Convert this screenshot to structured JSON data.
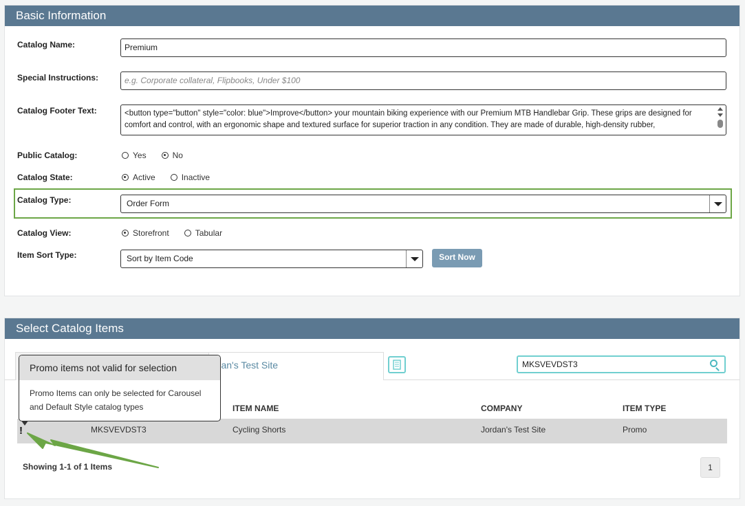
{
  "basic": {
    "header": "Basic Information",
    "catalog_name_label": "Catalog Name:",
    "catalog_name_value": "Premium",
    "special_label": "Special Instructions:",
    "special_placeholder": "e.g. Corporate collateral, Flipbooks, Under $100",
    "footer_label": "Catalog Footer Text:",
    "footer_value": "<button type=\"button\" style=\"color: blue\">Improve</button> your mountain biking experience with our Premium MTB Handlebar Grip. These grips are designed for comfort and control, with an ergonomic shape and textured surface for superior traction in any condition. They are made of durable, high-density rubber,",
    "public_label": "Public Catalog:",
    "public_yes": "Yes",
    "public_no": "No",
    "state_label": "Catalog State:",
    "state_active": "Active",
    "state_inactive": "Inactive",
    "type_label": "Catalog Type:",
    "type_value": "Order Form",
    "view_label": "Catalog View:",
    "view_storefront": "Storefront",
    "view_tabular": "Tabular",
    "sort_label": "Item Sort Type:",
    "sort_value": "Sort by Item Code",
    "sort_button": "Sort Now"
  },
  "items": {
    "header": "Select Catalog Items",
    "tab_label": "rdan's Test Site",
    "search_value": "MKSVEVDST3",
    "columns": [
      "ITEM NAME",
      "COMPANY",
      "ITEM TYPE"
    ],
    "row": {
      "code": "MKSVEVDST3",
      "name": "Cycling Shorts",
      "company": "Jordan's Test Site",
      "type": "Promo",
      "flag": "!"
    },
    "showing": "Showing 1-1 of 1 Items",
    "page": "1",
    "tooltip_title": "Promo items not valid for selection",
    "tooltip_body": "Promo Items can only be selected for Carousel and Default Style catalog types"
  },
  "colors": {
    "header_bg": "#5a7891",
    "highlight": "#6ca646",
    "accent_cyan": "#70cfd0",
    "arrow": "#6ca646"
  },
  "icons": [
    "caret-down-icon",
    "search-icon",
    "barcode-icon",
    "warning-icon"
  ]
}
